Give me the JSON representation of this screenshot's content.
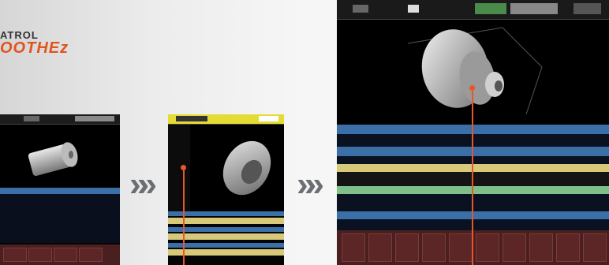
{
  "brand": {
    "line1": "ATROL",
    "line2": "OOTHEz"
  },
  "steps": {
    "arrow_glyph": "»»"
  },
  "colors": {
    "accent": "#e8562a",
    "band_blue": "#3a6fa8",
    "band_yellow": "#d8c97a",
    "band_green": "#7fbf8a",
    "bottom_keys": "#5c2626"
  },
  "icons": [
    "double-chevron-right-icon",
    "cylinder-3d-model"
  ]
}
